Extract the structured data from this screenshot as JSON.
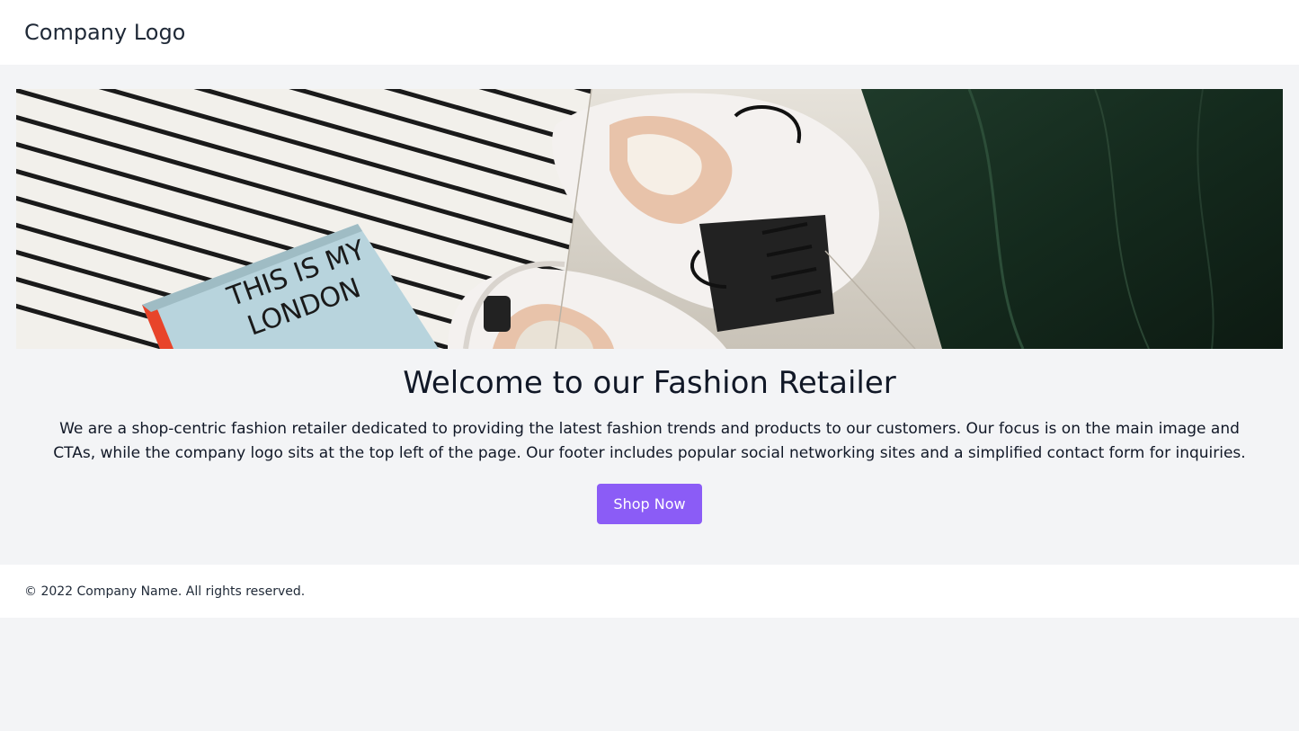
{
  "header": {
    "logo_text": "Company Logo"
  },
  "hero": {
    "image_alt": "Flat lay of sneakers, striped fabric, a book titled THIS IS MY LONDON and dark green cloth",
    "book_text_line1": "THIS IS MY",
    "book_text_line2": "LONDON"
  },
  "main": {
    "title": "Welcome to our Fashion Retailer",
    "description": "We are a shop-centric fashion retailer dedicated to providing the latest fashion trends and products to our customers. Our focus is on the main image and CTAs, while the company logo sits at the top left of the page. Our footer includes popular social networking sites and a simplified contact form for inquiries.",
    "cta_label": "Shop Now"
  },
  "footer": {
    "copyright": "© 2022 Company Name. All rights reserved."
  },
  "colors": {
    "accent": "#8b5cf6",
    "page_background": "#f3f4f6",
    "header_background": "#ffffff"
  }
}
